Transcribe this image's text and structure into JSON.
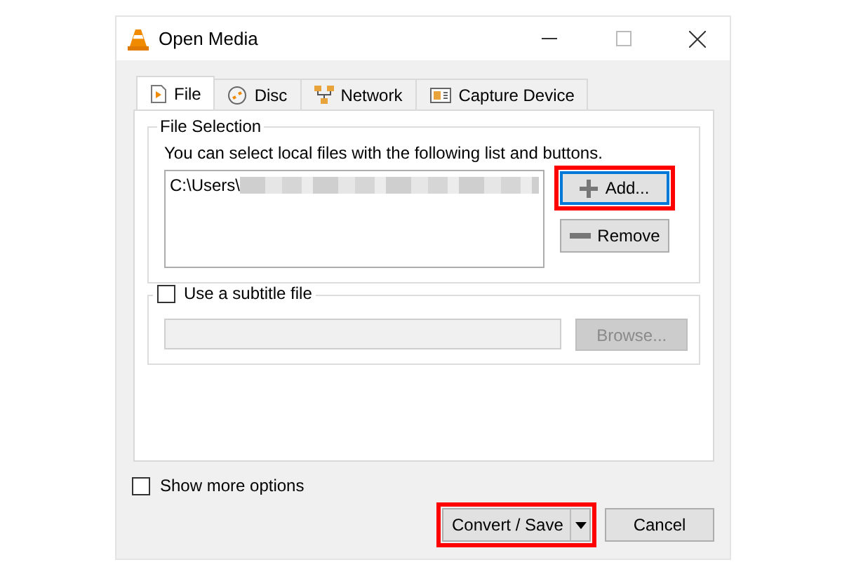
{
  "window": {
    "title": "Open Media"
  },
  "tabs": [
    {
      "label": "File",
      "selected": true
    },
    {
      "label": "Disc",
      "selected": false
    },
    {
      "label": "Network",
      "selected": false
    },
    {
      "label": "Capture Device",
      "selected": false
    }
  ],
  "file_selection": {
    "title": "File Selection",
    "hint": "You can select local files with the following list and buttons.",
    "files": [
      {
        "path": "C:\\Users\\",
        "redacted": true
      }
    ],
    "buttons": [
      {
        "label": "Add...",
        "focused": true,
        "highlighted": true
      },
      {
        "label": "Remove",
        "focused": false,
        "highlighted": false
      }
    ]
  },
  "subtitle": {
    "label": "Use a subtitle file",
    "checked": false,
    "browse": {
      "label": "Browse...",
      "disabled": true
    }
  },
  "show_more_options": {
    "label": "Show more options",
    "checked": false
  },
  "buttons": [
    {
      "label": "Convert / Save",
      "kind": "split",
      "highlighted": true
    },
    {
      "label": "Cancel",
      "kind": "plain",
      "highlighted": false
    }
  ]
}
